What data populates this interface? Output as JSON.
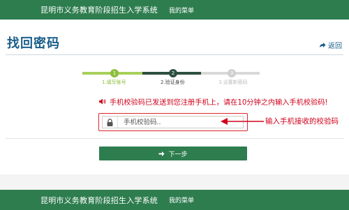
{
  "header": {
    "system_title": "昆明市义务教育阶段招生入学系统",
    "menu_label": "我的菜单"
  },
  "page": {
    "title": "找回密码",
    "back_label": "返回"
  },
  "steps": [
    {
      "number": "1",
      "label": "1.填写账号"
    },
    {
      "number": "2",
      "label": "2.验证身份"
    },
    {
      "number": "3",
      "label": "3.设置新密码"
    }
  ],
  "notice": {
    "text": "手机校验码已发送到您注册手机上，请在10分钟之内输入手机校验码!"
  },
  "code_field": {
    "placeholder": "手机校验码.."
  },
  "annotation": {
    "text": "输入手机接收的校验码"
  },
  "next_button": {
    "label": "下一步"
  },
  "footer": {
    "system_title": "昆明市义务教育阶段招生入学系统",
    "menu_label": "我的菜单"
  },
  "colors": {
    "brand_green": "#2e7d4f",
    "link_blue": "#1b5e8a",
    "alert_red": "#d0021b",
    "step_done": "#8bbf3c",
    "step_current": "#2e4f3f",
    "step_pending": "#cfcfcf"
  },
  "icons": {
    "back": "share-arrow-icon",
    "notice": "speaker-icon",
    "field": "lock-icon",
    "button": "arrow-right-icon"
  }
}
